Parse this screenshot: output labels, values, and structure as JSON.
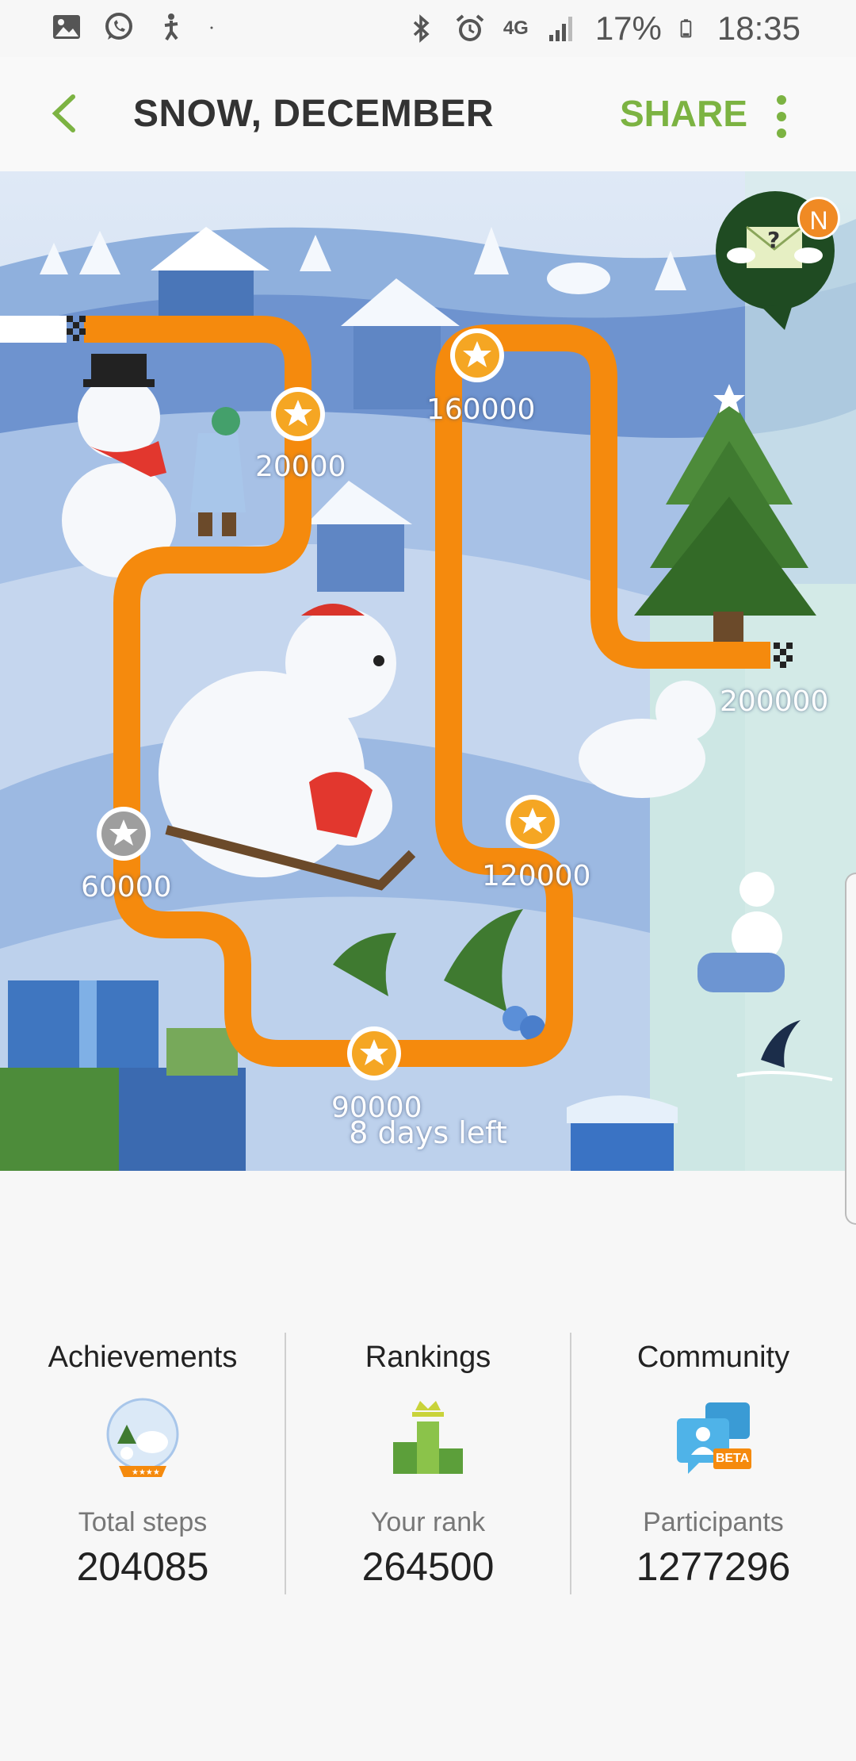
{
  "status_bar": {
    "network": "4G",
    "battery": "17%",
    "time": "18:35",
    "left_icons": [
      "gallery-icon",
      "whatsapp-icon",
      "accessibility-icon",
      "dot-icon"
    ],
    "right_icons": [
      "bluetooth-icon",
      "alarm-icon",
      "signal-icon",
      "battery-icon"
    ]
  },
  "app_bar": {
    "title": "SNOW, DECEMBER",
    "share_label": "SHARE",
    "accent": "#7cb342"
  },
  "challenge_map": {
    "path_color": "#f58a0d",
    "badge_text": "N",
    "milestones": [
      {
        "steps": "20000",
        "achieved": true
      },
      {
        "steps": "60000",
        "achieved": false
      },
      {
        "steps": "90000",
        "achieved": true
      },
      {
        "steps": "120000",
        "achieved": true
      },
      {
        "steps": "160000",
        "achieved": true
      },
      {
        "steps": "200000",
        "achieved": true
      }
    ],
    "days_left": "8 days left"
  },
  "stats": {
    "achievements": {
      "title": "Achievements",
      "label": "Total steps",
      "value": "204085"
    },
    "rankings": {
      "title": "Rankings",
      "label": "Your rank",
      "value": "264500"
    },
    "community": {
      "title": "Community",
      "label": "Participants",
      "value": "1277296",
      "badge": "BETA"
    }
  }
}
